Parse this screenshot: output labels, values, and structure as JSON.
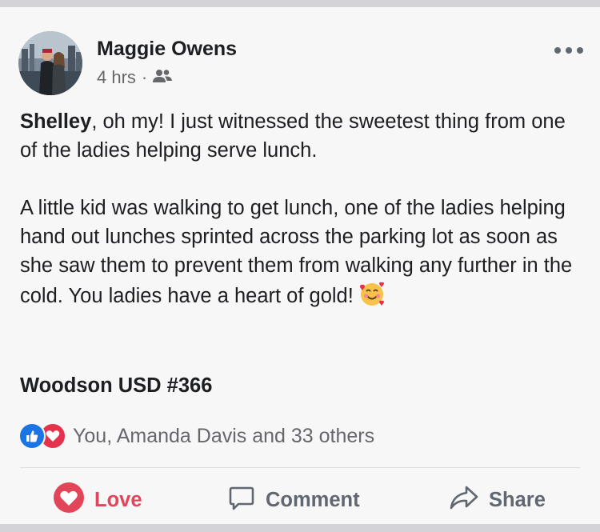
{
  "post": {
    "author": "Maggie Owens",
    "time": "4 hrs",
    "separator": "·",
    "mention": "Shelley",
    "paragraph1_rest": ", oh my! I just witnessed the sweetest thing from one of the ladies helping serve lunch.",
    "paragraph2": "A little kid was walking to get lunch, one of the ladies helping hand out lunches sprinted across the parking lot as soon as she saw them to prevent them from walking any further in the cold. You ladies have a heart of gold!",
    "emoji": "smiling-face-with-hearts",
    "page_tag": "Woodson USD #366",
    "privacy_icon": "friends-icon"
  },
  "reactions": {
    "icons": [
      "like-icon",
      "love-icon"
    ],
    "text": "You, Amanda Davis and 33 others"
  },
  "actions": {
    "love_label": "Love",
    "comment_label": "Comment",
    "share_label": "Share"
  },
  "colors": {
    "love": "#e0455a",
    "like": "#1b74e4",
    "text": "#1c1e21",
    "muted": "#65676b"
  }
}
